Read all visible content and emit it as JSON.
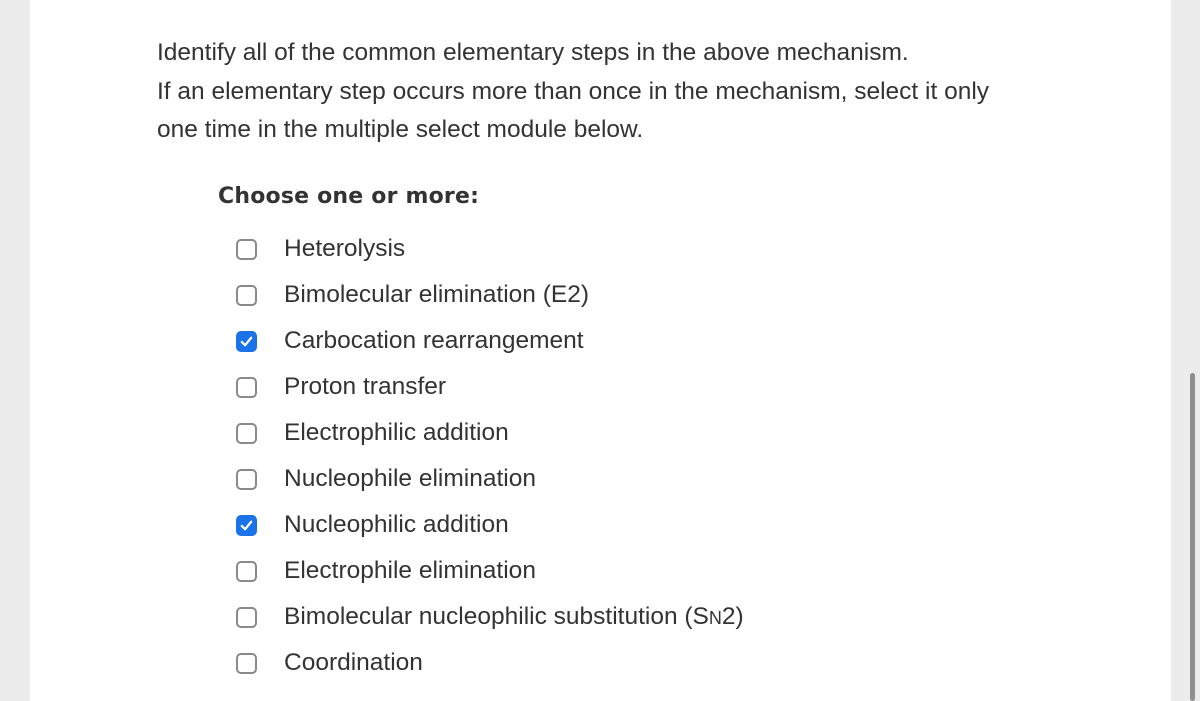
{
  "prompt": {
    "lines": [
      "Identify all of the common elementary steps in the above mechanism.",
      "If an elementary step occurs more than once in the mechanism, select it only",
      "one time in the multiple select module below."
    ]
  },
  "heading": "Choose one or more:",
  "colors": {
    "checked": "#1a73e8",
    "unchecked_border": "#8a8a8a"
  },
  "options": [
    {
      "label": "Heterolysis",
      "checked": false
    },
    {
      "label": "Bimolecular elimination (E2)",
      "checked": false
    },
    {
      "label": "Carbocation rearrangement",
      "checked": true
    },
    {
      "label": "Proton transfer",
      "checked": false
    },
    {
      "label": "Electrophilic addition",
      "checked": false
    },
    {
      "label": "Nucleophile elimination",
      "checked": false
    },
    {
      "label": "Nucleophilic addition",
      "checked": true
    },
    {
      "label": "Electrophile elimination",
      "checked": false
    },
    {
      "label_prefix": "Bimolecular nucleophilic substitution (S",
      "label_smallcap": "N",
      "label_suffix": "2)",
      "checked": false
    },
    {
      "label": "Coordination",
      "checked": false
    }
  ]
}
